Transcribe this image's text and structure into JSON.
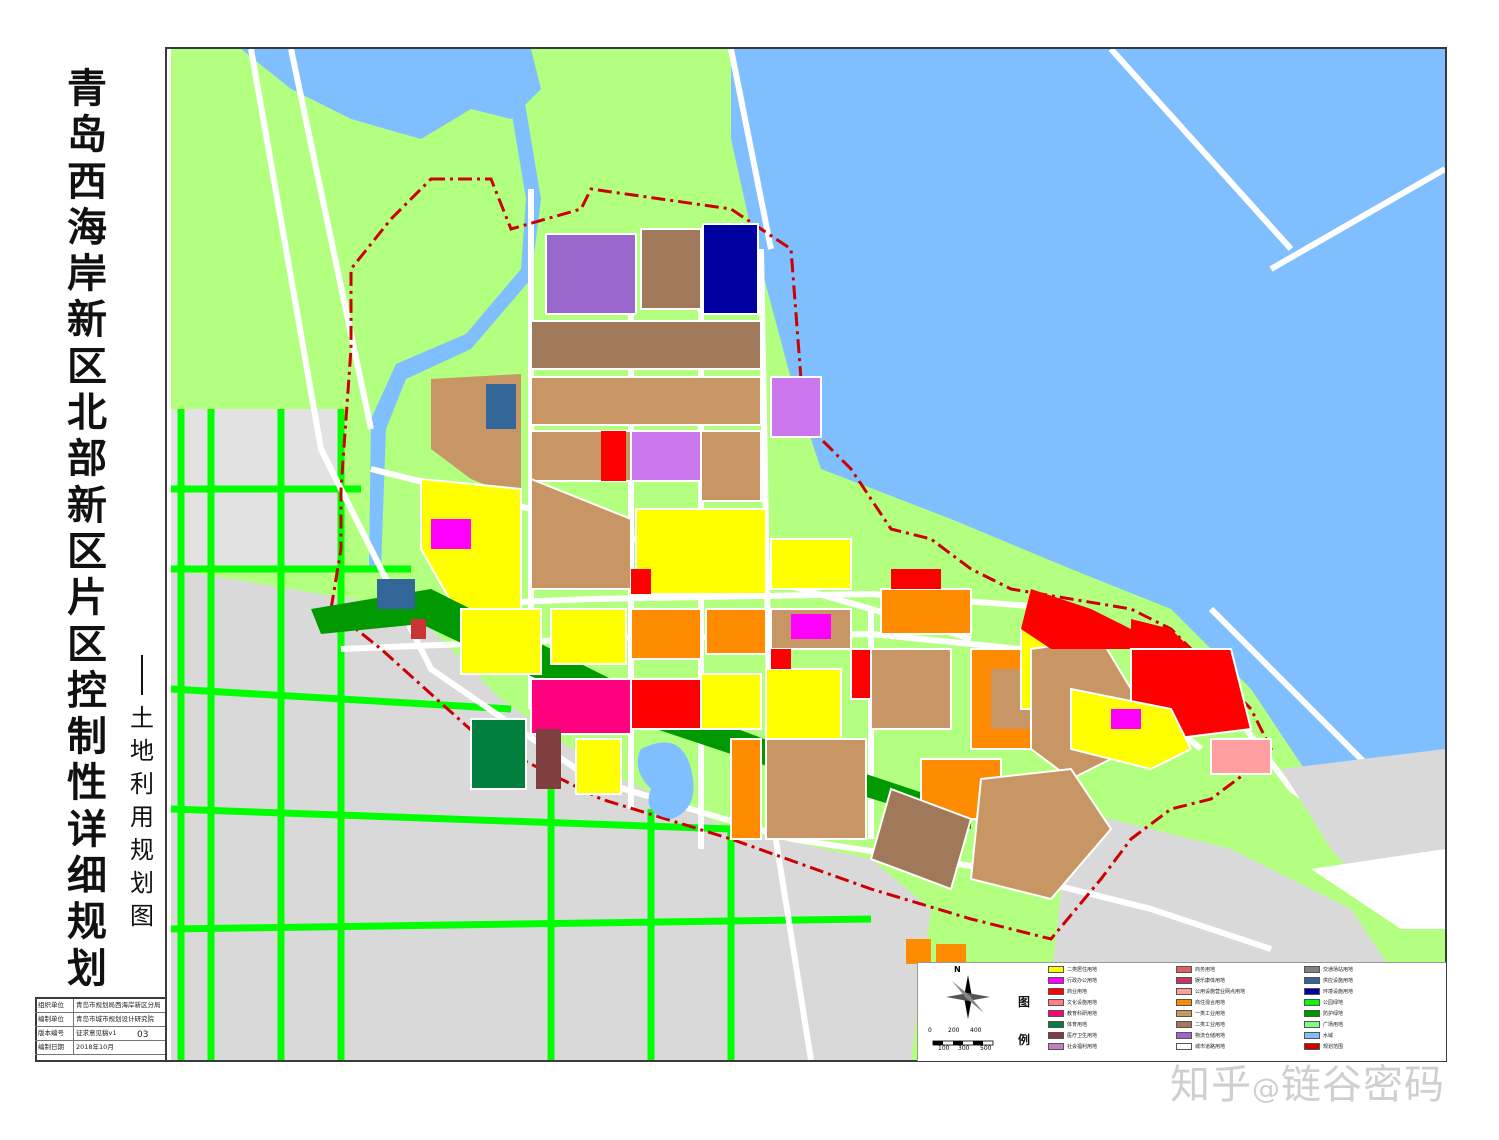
{
  "title": {
    "main": "青岛西海岸新区北部新区片区控制性详细规划",
    "dash": "——",
    "sub": "土地利用规划图"
  },
  "info_table": [
    {
      "key": "组织单位",
      "value": "青岛市规划局西海岸新区分局"
    },
    {
      "key": "编制单位",
      "value": "青岛市城市规划设计研究院"
    },
    {
      "key": "版本编号",
      "value": "征求意见稿v1"
    },
    {
      "key": "编制日期",
      "value": "2018年10月"
    }
  ],
  "sheet_number": "03",
  "legend": {
    "title": "图例",
    "north_label": "N",
    "scale_top": [
      "0",
      "200",
      "400"
    ],
    "scale_bottom": [
      "100",
      "300",
      "500"
    ],
    "items": [
      {
        "label": "二类居住用地",
        "color": "#ffff00"
      },
      {
        "label": "行政办公用地",
        "color": "#ff00ff"
      },
      {
        "label": "商业用地",
        "color": "#ff0000"
      },
      {
        "label": "文化设施用地",
        "color": "#ff7f7f"
      },
      {
        "label": "教育科研用地",
        "color": "#ff007f"
      },
      {
        "label": "体育用地",
        "color": "#007f3f"
      },
      {
        "label": "医疗卫生用地",
        "color": "#7f3f3f"
      },
      {
        "label": "社会福利用地",
        "color": "#bf7fbf"
      },
      {
        "label": "商务用地",
        "color": "#e06060"
      },
      {
        "label": "娱乐康体用地",
        "color": "#cc3366"
      },
      {
        "label": "公用设施营业网点用地",
        "color": "#ff9f9f"
      },
      {
        "label": "商住混合用地",
        "color": "#ff8c00"
      },
      {
        "label": "一类工业用地",
        "color": "#c89664"
      },
      {
        "label": "二类工业用地",
        "color": "#a0785a"
      },
      {
        "label": "物流仓储用地",
        "color": "#9966cc"
      },
      {
        "label": "城市道路用地",
        "color": "#ffffff"
      },
      {
        "label": "交通场站用地",
        "color": "#808080"
      },
      {
        "label": "供应设施用地",
        "color": "#336699"
      },
      {
        "label": "环境设施用地",
        "color": "#0000a0"
      },
      {
        "label": "公园绿地",
        "color": "#00ff00"
      },
      {
        "label": "防护绿地",
        "color": "#009900"
      },
      {
        "label": "广场用地",
        "color": "#7fff7f"
      },
      {
        "label": "水域",
        "color": "#7fbfff"
      },
      {
        "label": "规划范围",
        "color": "#cc0000"
      }
    ]
  },
  "watermark": {
    "part1": "知乎",
    "at": "@",
    "part2": "链谷密码"
  },
  "colors": {
    "water": "#7fbfff",
    "green": "#00ff00",
    "light_green": "#b3ff80",
    "residential": "#ffff00",
    "industrial": "#c89664",
    "commercial": "#ff0000",
    "mixed": "#ff8c00",
    "boundary": "#cc0000",
    "built_grey": "#d9d9d9"
  }
}
